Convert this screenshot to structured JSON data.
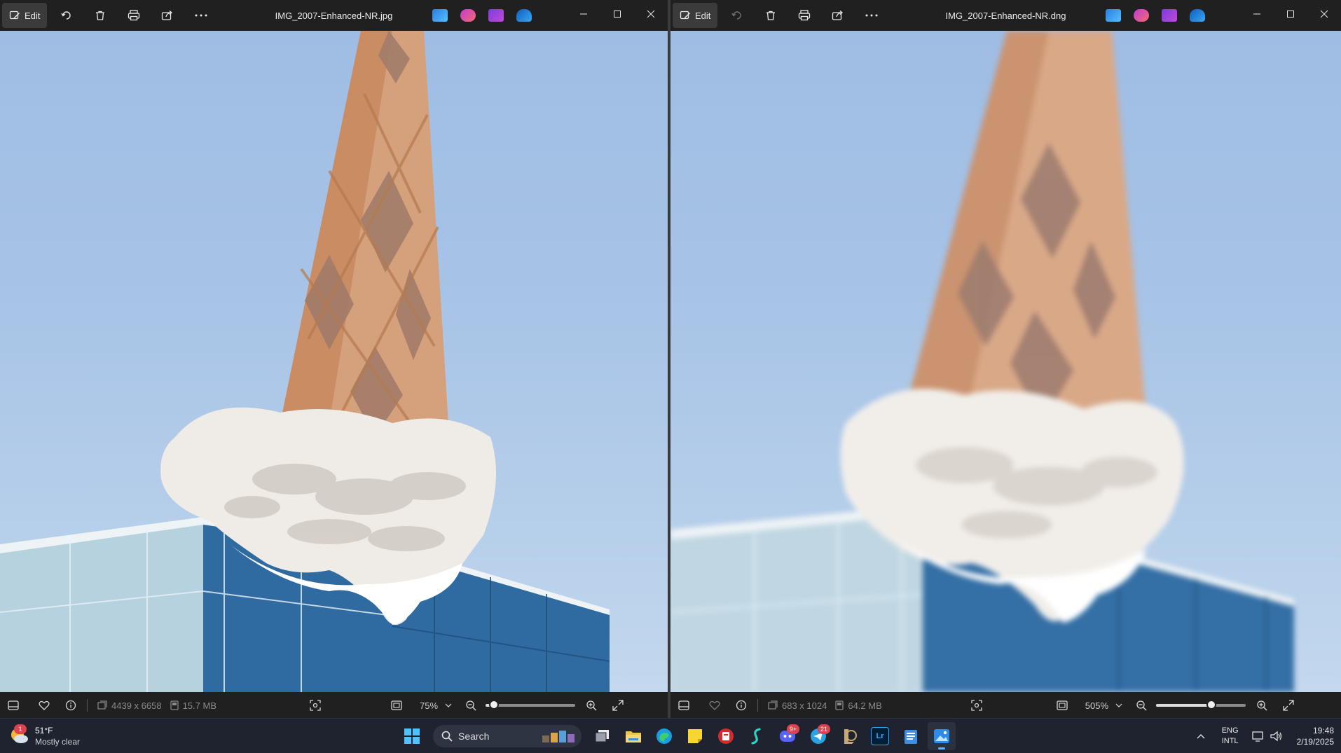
{
  "left_window": {
    "title": "IMG_2007-Enhanced-NR.jpg",
    "edit_label": "Edit",
    "dimensions": "4439 x 6658",
    "file_size": "15.7 MB",
    "zoom": "75%",
    "zoom_slider_fraction": 0.09
  },
  "right_window": {
    "title": "IMG_2007-Enhanced-NR.dng",
    "edit_label": "Edit",
    "dimensions": "683 x 1024",
    "file_size": "64.2 MB",
    "zoom": "505%",
    "zoom_slider_fraction": 0.62
  },
  "taskbar": {
    "weather_temp": "51°F",
    "weather_desc": "Mostly clear",
    "weather_badge": "1",
    "search_placeholder": "Search",
    "discord_badge": "9+",
    "telegram_badge": "21",
    "lightroom_label": "Lr",
    "lang_primary": "ENG",
    "lang_secondary": "INTL",
    "time": "19:48",
    "date": "2/19/2025"
  },
  "colors": {
    "accent": "#5fb2ff",
    "sky": "#a7c3e6",
    "cone": "#d7a27b",
    "ice_cream": "#f1eeea",
    "glass": "#3c76aa"
  }
}
